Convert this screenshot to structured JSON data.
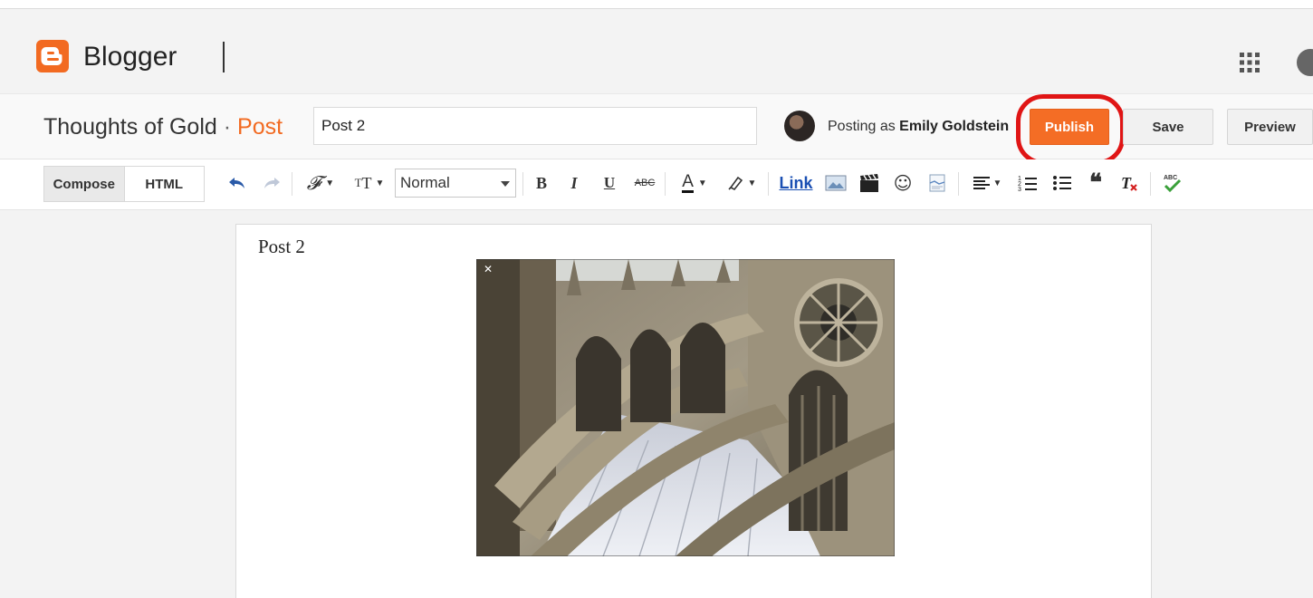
{
  "app": {
    "brand": "Blogger"
  },
  "post": {
    "blog_name": "Thoughts of Gold",
    "separator": "·",
    "kind": "Post",
    "title_value": "Post 2",
    "posting_as_prefix": "Posting as",
    "author": "Emily Goldstein",
    "publish_label": "Publish",
    "save_label": "Save",
    "preview_label": "Preview"
  },
  "toolbar": {
    "compose_label": "Compose",
    "html_label": "HTML",
    "format_value": "Normal",
    "bold": "B",
    "italic": "I",
    "underline": "U",
    "strike": "ABC",
    "link_label": "Link",
    "spell_abc": "ABC"
  },
  "editor": {
    "body_line": "Post 2"
  },
  "colors": {
    "accent": "#f46d25",
    "brand": "#f26a21",
    "highlight": "#e01515",
    "link": "#1a4fb3"
  },
  "icons": [
    "blogger-logo-icon",
    "apps-grid-icon",
    "undo-icon",
    "redo-icon",
    "font-icon",
    "font-size-icon",
    "text-color-icon",
    "highlight-icon",
    "image-icon",
    "video-icon",
    "emoji-icon",
    "jump-break-icon",
    "align-icon",
    "numbered-list-icon",
    "bullet-list-icon",
    "quote-icon",
    "clear-format-icon",
    "spell-check-icon"
  ]
}
